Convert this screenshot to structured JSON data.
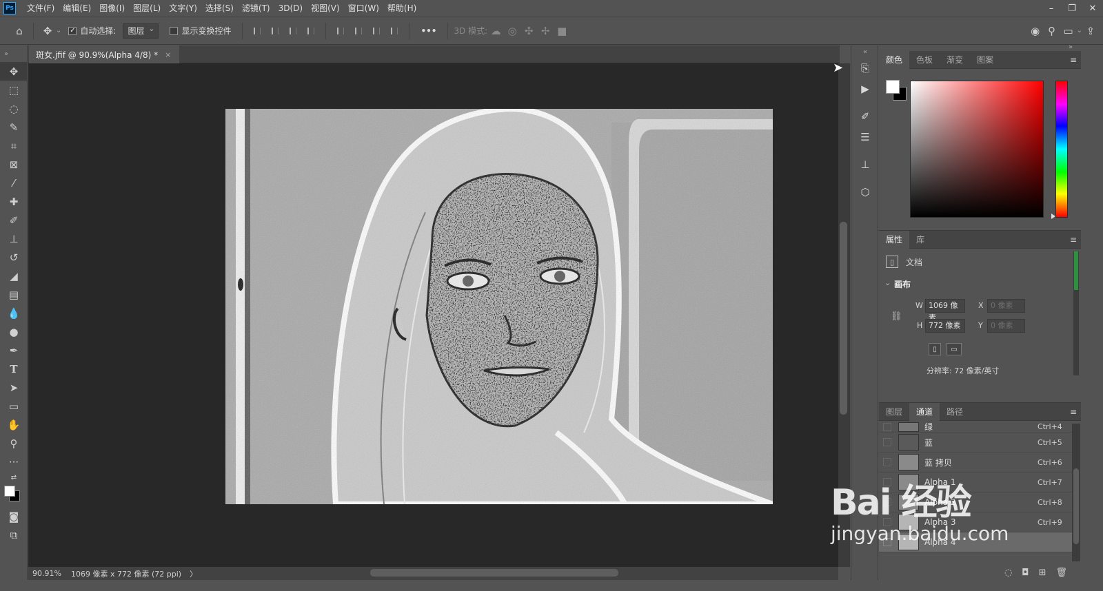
{
  "app": {
    "logo": "Ps"
  },
  "menu": [
    "文件(F)",
    "编辑(E)",
    "图像(I)",
    "图层(L)",
    "文字(Y)",
    "选择(S)",
    "滤镜(T)",
    "3D(D)",
    "视图(V)",
    "窗口(W)",
    "帮助(H)"
  ],
  "window_controls": {
    "minimize": "–",
    "restore": "❐",
    "close": "✕"
  },
  "options": {
    "auto_select_label": "自动选择:",
    "auto_select_checked": true,
    "target_value": "图层",
    "show_transform_label": "显示变换控件",
    "more": "•••",
    "mode_3d_label": "3D 模式:"
  },
  "document": {
    "tab_title": "斑女.jfif @ 90.9%(Alpha 4/8) *",
    "tab_close": "×"
  },
  "status": {
    "zoom": "90.91%",
    "doc_info": "1069 像素 x 772 像素 (72 ppi)",
    "arrow": "〉"
  },
  "color_panel": {
    "tabs": [
      "颜色",
      "色板",
      "渐变",
      "图案"
    ],
    "active": 0,
    "hue_color": "#ff0000"
  },
  "properties_panel": {
    "tabs": [
      "属性",
      "库"
    ],
    "doc_label": "文档",
    "section": "画布",
    "w_label": "W",
    "w_value": "1069 像素",
    "h_label": "H",
    "h_value": "772 像素",
    "x_label": "X",
    "x_value": "0 像素",
    "y_label": "Y",
    "y_value": "0 像素",
    "resolution": "分辨率: 72 像素/英寸"
  },
  "channels_panel": {
    "tabs": [
      "图层",
      "通道",
      "路径"
    ],
    "active": 1,
    "rows": [
      {
        "name": "绿",
        "shortcut": "Ctrl+4"
      },
      {
        "name": "蓝",
        "shortcut": "Ctrl+5"
      },
      {
        "name": "蓝 拷贝",
        "shortcut": "Ctrl+6"
      },
      {
        "name": "Alpha 1",
        "shortcut": "Ctrl+7"
      },
      {
        "name": "Alpha 2",
        "shortcut": "Ctrl+8"
      },
      {
        "name": "Alpha 3",
        "shortcut": "Ctrl+9"
      },
      {
        "name": "Alpha 4",
        "shortcut": ""
      }
    ]
  },
  "watermark": {
    "line1": "Bai 经验",
    "line2": "jingyan.baidu.com"
  }
}
